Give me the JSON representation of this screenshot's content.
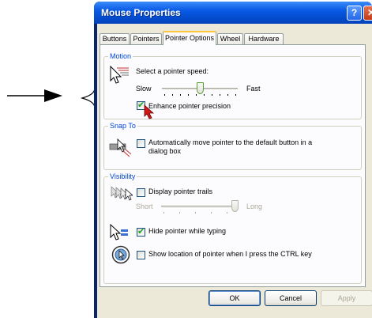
{
  "window": {
    "title": "Mouse Properties",
    "help_glyph": "?",
    "close_glyph": "✕"
  },
  "tabs": [
    {
      "label": "Buttons"
    },
    {
      "label": "Pointers"
    },
    {
      "label": "Pointer Options"
    },
    {
      "label": "Wheel"
    },
    {
      "label": "Hardware"
    }
  ],
  "active_tab": "Pointer Options",
  "motion": {
    "legend": "Motion",
    "speed_label": "Select a pointer speed:",
    "slow_label": "Slow",
    "fast_label": "Fast",
    "speed_fraction": 0.5,
    "precision_label": "Enhance pointer precision",
    "precision_checked": true
  },
  "snap_to": {
    "legend": "Snap To",
    "label_line1": "Automatically move pointer to the default button in a",
    "label_line2": "dialog box",
    "checked": false
  },
  "visibility": {
    "legend": "Visibility",
    "trails_label": "Display pointer trails",
    "trails_checked": false,
    "short_label": "Short",
    "long_label": "Long",
    "trail_fraction": 1.0,
    "hide_typing_label": "Hide pointer while typing",
    "hide_typing_checked": true,
    "show_location_label": "Show location of pointer when I press the CTRL key",
    "show_location_checked": false
  },
  "buttons": {
    "ok": "OK",
    "cancel": "Cancel",
    "apply": "Apply"
  },
  "colors": {
    "legend": "#0046d5",
    "titlebar": "#0552d8",
    "active_tab_accent": "#ffc83c",
    "checkmark": "#21a121"
  },
  "icons": [
    "arrow-pointer-icon",
    "curly-brace-icon",
    "pointer-speed-icon",
    "snap-to-icon",
    "pointer-trails-icon",
    "hide-pointer-icon",
    "show-location-icon",
    "cursor-arrow-icon"
  ]
}
